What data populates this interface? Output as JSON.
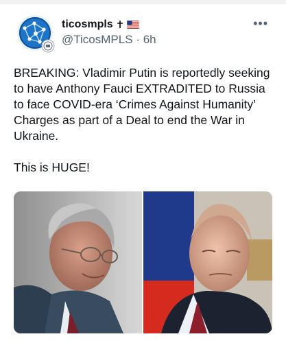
{
  "tweet": {
    "display_name": "ticosmpls",
    "name_emoji_cross": "✝",
    "handle": "@TicosMPLS",
    "separator": "·",
    "time": "6h",
    "more_icon": "more-dots-icon",
    "text": "BREAKING: Vladimir Putin is reportedly seeking to have Anthony Fauci EXTRADITED to Russia to face COVID-era ‘Crimes Against Humanity’ Charges as part of a Deal to end the War in Ukraine.\n\nThis is HUGE!",
    "avatar_icon": "globe-network-logo",
    "media": {
      "type": "photo",
      "left_panel_icon": "man-portrait-glasses",
      "right_panel_icon": "man-portrait-flag-background"
    }
  },
  "colors": {
    "text_primary": "#0f1419",
    "text_secondary": "#536471",
    "flag_red": "#d52b1e",
    "flag_blue": "#1f3a8a"
  }
}
